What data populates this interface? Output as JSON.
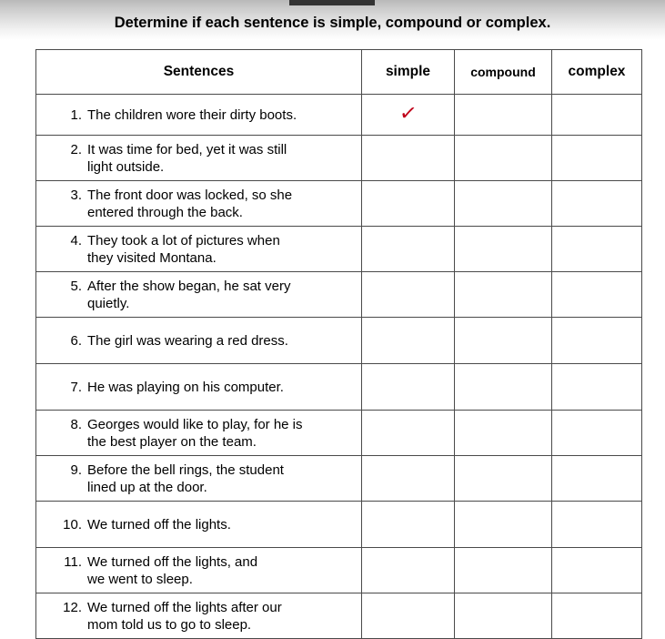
{
  "page": {
    "title": "Determine if each sentence is simple, compound or complex.",
    "accent_header_bg": "#dce6f4",
    "check_color": "#c00019",
    "border_color": "#4a4a4a"
  },
  "table": {
    "columns": {
      "sentences": "Sentences",
      "simple": "simple",
      "compound": "compound",
      "complex": "complex"
    },
    "rows": [
      {
        "number": "1.",
        "lines": [
          "The children wore their dirty boots."
        ],
        "simple": "✓",
        "compound": "",
        "complex": ""
      },
      {
        "number": "2.",
        "lines": [
          "It was time for bed, yet it was still",
          "light outside."
        ],
        "simple": "",
        "compound": "",
        "complex": ""
      },
      {
        "number": "3.",
        "lines": [
          "The front door was locked, so she",
          "entered through the back."
        ],
        "simple": "",
        "compound": "",
        "complex": ""
      },
      {
        "number": "4.",
        "lines": [
          "They took a lot of pictures when",
          "they visited Montana."
        ],
        "simple": "",
        "compound": "",
        "complex": ""
      },
      {
        "number": "5.",
        "lines": [
          "After the show began, he sat very",
          "quietly."
        ],
        "simple": "",
        "compound": "",
        "complex": ""
      },
      {
        "number": "6.",
        "lines": [
          "The girl was wearing a red dress."
        ],
        "simple": "",
        "compound": "",
        "complex": ""
      },
      {
        "number": "7.",
        "lines": [
          "He was playing on his computer."
        ],
        "simple": "",
        "compound": "",
        "complex": ""
      },
      {
        "number": "8.",
        "lines": [
          "Georges would like to play, for he is",
          "the best player on the team."
        ],
        "simple": "",
        "compound": "",
        "complex": ""
      },
      {
        "number": "9.",
        "lines": [
          "Before the bell rings, the student",
          "lined up at the door."
        ],
        "simple": "",
        "compound": "",
        "complex": ""
      },
      {
        "number": "10.",
        "lines": [
          "We turned off the lights."
        ],
        "simple": "",
        "compound": "",
        "complex": ""
      },
      {
        "number": "11.",
        "lines": [
          "We turned off the lights, and",
          "we went to sleep."
        ],
        "simple": "",
        "compound": "",
        "complex": ""
      },
      {
        "number": "12.",
        "lines": [
          "We turned off the lights after our",
          "mom told us to go to sleep."
        ],
        "simple": "",
        "compound": "",
        "complex": ""
      }
    ]
  }
}
